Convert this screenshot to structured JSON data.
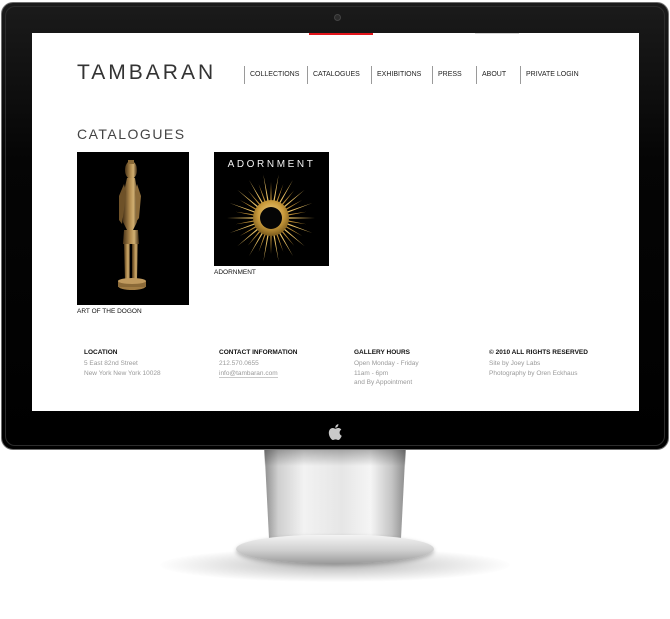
{
  "site": {
    "logo": "TAMBARAN",
    "nav": [
      {
        "label": "COLLECTIONS"
      },
      {
        "label": "CATALOGUES"
      },
      {
        "label": "EXHIBITIONS"
      },
      {
        "label": "PRESS"
      },
      {
        "label": "ABOUT"
      },
      {
        "label": "PRIVATE LOGIN"
      }
    ],
    "active_nav": "CATALOGUES",
    "accent_color": "#e3151b"
  },
  "page": {
    "heading": "CATALOGUES",
    "catalogues": [
      {
        "caption": "ART OF THE DOGON",
        "image": "dogon-figure-sculpture"
      },
      {
        "caption": "ADORNMENT",
        "image": "adornment-sunburst-ornament",
        "cover_title": "ADORNMENT"
      }
    ]
  },
  "footer": {
    "location": {
      "heading": "LOCATION",
      "lines": [
        "5 East 82nd Street",
        "New York New York 10028"
      ]
    },
    "contact": {
      "heading": "CONTACT INFORMATION",
      "phone": "212.570.0655",
      "email": "info@tambaran.com"
    },
    "hours": {
      "heading": "GALLERY HOURS",
      "lines": [
        "Open Monday - Friday",
        "11am - 6pm",
        "and By Appointment"
      ]
    },
    "rights": {
      "heading": "© 2010 ALL RIGHTS RESERVED",
      "lines": [
        "Site by Joey Labs",
        "Photography by Oren Eckhaus"
      ]
    }
  },
  "hardware": {
    "camera": "camera-lens",
    "badge": "apple-logo-icon"
  }
}
